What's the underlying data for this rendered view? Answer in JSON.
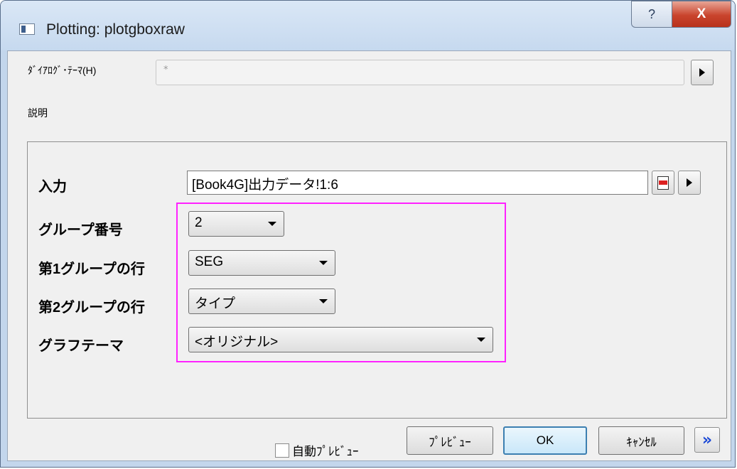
{
  "window": {
    "title": "Plotting: plotgboxraw",
    "help_glyph": "?",
    "close_glyph": "X"
  },
  "theme": {
    "label": "ﾀﾞｲｱﾛｸﾞ･ﾃｰﾏ(H)",
    "value": "*"
  },
  "description": {
    "label": "説明"
  },
  "form": {
    "input": {
      "label": "入力",
      "value": "[Book4G]出力データ!1:6"
    },
    "group_number": {
      "label": "グループ番号",
      "value": "2"
    },
    "group1_row": {
      "label": "第1グループの行",
      "value": "SEG"
    },
    "group2_row": {
      "label": "第2グループの行",
      "value": "タイプ"
    },
    "graph_theme": {
      "label": "グラフテーマ",
      "value": "<オリジナル>"
    }
  },
  "footer": {
    "auto_preview_label": "自動ﾌﾟﾚﾋﾞｭｰ",
    "auto_preview_checked": false,
    "preview_label": "ﾌﾟﾚﾋﾞｭｰ",
    "ok_label": "OK",
    "cancel_label": "ｷｬﾝｾﾙ",
    "more_glyph": "»"
  },
  "colors": {
    "highlight": "#ff22ff",
    "ok_border": "#3c7fb1",
    "close_button": "#c9442d"
  }
}
